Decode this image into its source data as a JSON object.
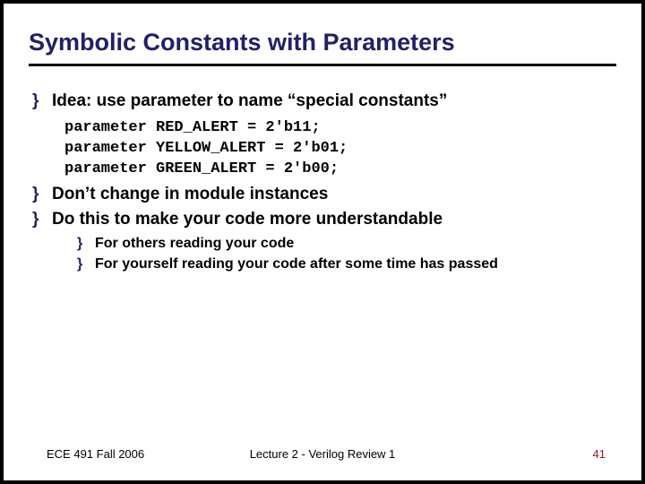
{
  "title": "Symbolic Constants with Parameters",
  "bullets": {
    "b1": "Idea: use parameter to name “special constants”",
    "code": "parameter RED_ALERT = 2'b11;\nparameter YELLOW_ALERT = 2'b01;\nparameter GREEN_ALERT = 2'b00;",
    "b2": "Don’t change in module instances",
    "b3": "Do this to make your code more understandable",
    "sub1": "For others reading your code",
    "sub2": "For yourself reading your code after some time has passed"
  },
  "footer": {
    "left": "ECE 491 Fall 2006",
    "center": "Lecture 2 - Verilog Review 1",
    "right": "41"
  }
}
